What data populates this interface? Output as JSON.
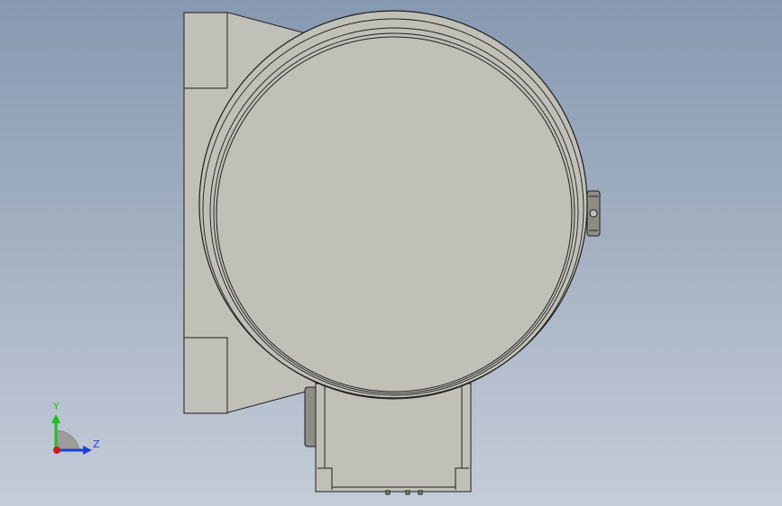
{
  "viewport": {
    "background_top": "#8799b1",
    "background_bottom": "#c5ccd8"
  },
  "model": {
    "part_fill": "#c0c0b8",
    "outline": "#1e1e1e"
  },
  "triad": {
    "y_label": "Y",
    "z_label": "Z",
    "y_color": "#1fbf1f",
    "z_color": "#1f3fd8",
    "origin_color": "#d01818"
  }
}
